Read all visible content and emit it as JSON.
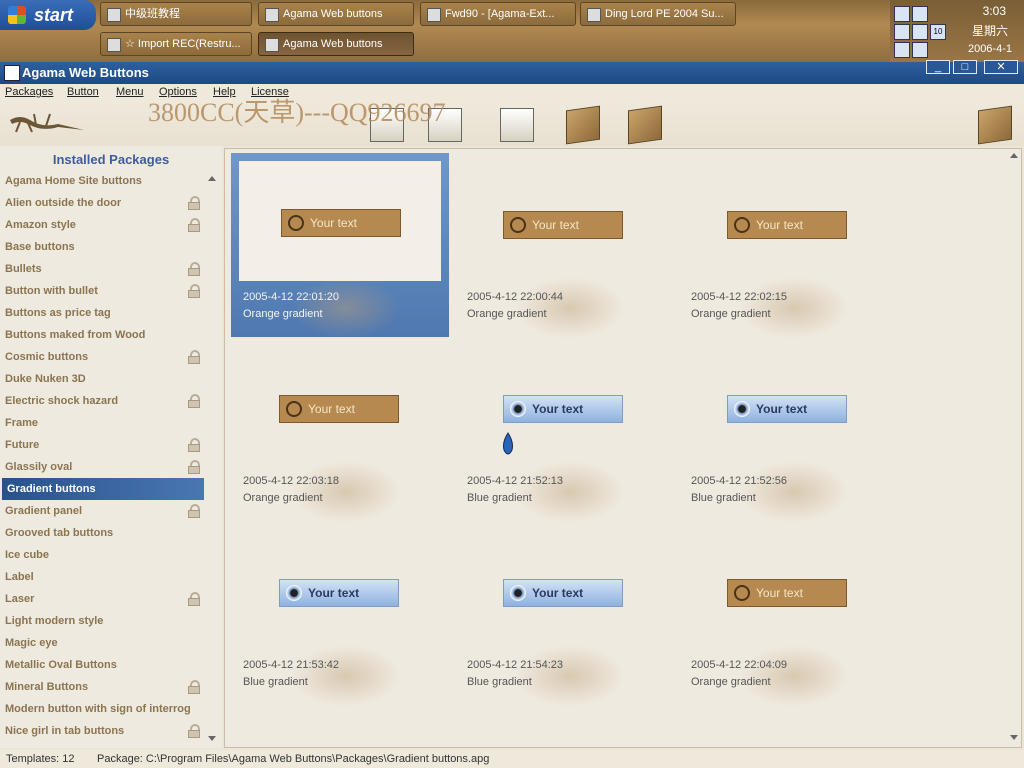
{
  "taskbar": {
    "start_label": "start",
    "tasks": [
      {
        "label": "中级班教程"
      },
      {
        "label": "Agama Web buttons"
      },
      {
        "label": "Fwd90 - [Agama-Ext..."
      },
      {
        "label": "Ding Lord PE 2004 Su..."
      },
      {
        "label": "☆ Import REC(Restru..."
      },
      {
        "label": "Agama Web buttons"
      }
    ],
    "clock": {
      "time": "3:03",
      "day": "星期六",
      "date": "2006-4-1"
    },
    "tray_badge": "10"
  },
  "window": {
    "title": "Agama Web Buttons",
    "controls": {
      "minimize": "_",
      "maximize": "□",
      "close": "✕"
    }
  },
  "menu": {
    "items": [
      "Packages",
      "Button",
      "Menu",
      "Options",
      "Help",
      "License"
    ]
  },
  "watermark": "3800CC(天草)---QQ926697",
  "toolbar": {
    "icons": [
      "lizard-logo",
      "new-page-icon",
      "edit-page-icon",
      "export-page-icon",
      "package-icon",
      "package-open-icon",
      "web-icon"
    ]
  },
  "left_panel": {
    "title": "Installed Packages",
    "packages": [
      {
        "name": "Agama Home Site buttons",
        "locked": false
      },
      {
        "name": "Alien outside the door",
        "locked": true
      },
      {
        "name": "Amazon style",
        "locked": true
      },
      {
        "name": "Base buttons",
        "locked": false
      },
      {
        "name": "Bullets",
        "locked": true
      },
      {
        "name": "Button with bullet",
        "locked": true
      },
      {
        "name": "Buttons as price tag",
        "locked": false
      },
      {
        "name": "Buttons maked from Wood",
        "locked": false
      },
      {
        "name": "Cosmic buttons",
        "locked": true
      },
      {
        "name": "Duke Nuken 3D",
        "locked": false
      },
      {
        "name": "Electric shock hazard",
        "locked": true
      },
      {
        "name": "Frame",
        "locked": false
      },
      {
        "name": "Future",
        "locked": true
      },
      {
        "name": "Glassily oval",
        "locked": true
      },
      {
        "name": "Gradient buttons",
        "locked": false,
        "selected": true
      },
      {
        "name": "Gradient panel",
        "locked": true
      },
      {
        "name": "Grooved tab buttons",
        "locked": false
      },
      {
        "name": "Ice cube",
        "locked": false
      },
      {
        "name": "Label",
        "locked": false
      },
      {
        "name": "Laser",
        "locked": true
      },
      {
        "name": "Light modern style",
        "locked": false
      },
      {
        "name": "Magic eye",
        "locked": false
      },
      {
        "name": "Metallic Oval Buttons",
        "locked": false
      },
      {
        "name": "Mineral Buttons",
        "locked": true
      },
      {
        "name": "Modern button with sign of interrog",
        "locked": false
      },
      {
        "name": "Nice girl in tab buttons",
        "locked": true
      }
    ]
  },
  "templates": [
    {
      "timestamp": "2005-4-12 22:01:20",
      "name": "Orange gradient",
      "style": "orange",
      "button_text": "Your text",
      "selected": true
    },
    {
      "timestamp": "2005-4-12 22:00:44",
      "name": "Orange gradient",
      "style": "orange",
      "button_text": "Your text"
    },
    {
      "timestamp": "2005-4-12 22:02:15",
      "name": "Orange gradient",
      "style": "orange",
      "button_text": "Your text"
    },
    {
      "timestamp": "2005-4-12 22:03:18",
      "name": "Orange gradient",
      "style": "orange",
      "button_text": "Your text"
    },
    {
      "timestamp": "2005-4-12 21:52:13",
      "name": "Blue gradient",
      "style": "blue",
      "button_text": "Your text"
    },
    {
      "timestamp": "2005-4-12 21:52:56",
      "name": "Blue gradient",
      "style": "blue",
      "button_text": "Your text"
    },
    {
      "timestamp": "2005-4-12 21:53:42",
      "name": "Blue gradient",
      "style": "blue",
      "button_text": "Your text"
    },
    {
      "timestamp": "2005-4-12 21:54:23",
      "name": "Blue gradient",
      "style": "blue",
      "button_text": "Your text"
    },
    {
      "timestamp": "2005-4-12 22:04:09",
      "name": "Orange gradient",
      "style": "orange",
      "button_text": "Your text"
    }
  ],
  "status": {
    "templates_count": "Templates: 12",
    "package_path": "Package: C:\\Program Files\\Agama Web Buttons\\Packages\\Gradient buttons.apg"
  },
  "colors": {
    "orange_button": "#b58950",
    "blue_button": "#8fb2e0",
    "selection": "#28528e",
    "titlebar": "#2f5f9e"
  }
}
